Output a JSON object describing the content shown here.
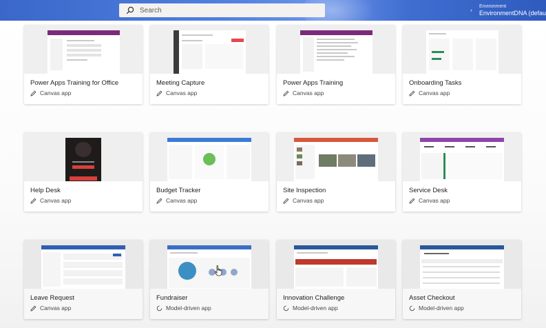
{
  "header": {
    "search_placeholder": "Search",
    "environment_label": "Environment",
    "environment_name": "EnvironmentDNA (defau"
  },
  "apps": [
    {
      "title": "Power Apps Training for Office",
      "type": "Canvas app",
      "type_icon": "pencil-icon",
      "accent": "#7b2a7b",
      "dark_thumb": false
    },
    {
      "title": "Meeting Capture",
      "type": "Canvas app",
      "type_icon": "pencil-icon",
      "accent": "#e8474c",
      "dark_thumb": false
    },
    {
      "title": "Power Apps Training",
      "type": "Canvas app",
      "type_icon": "pencil-icon",
      "accent": "#7b2a7b",
      "dark_thumb": false
    },
    {
      "title": "Onboarding Tasks",
      "type": "Canvas app",
      "type_icon": "pencil-icon",
      "accent": "#2e8b57",
      "dark_thumb": false
    },
    {
      "title": "Help Desk",
      "type": "Canvas app",
      "type_icon": "pencil-icon",
      "accent": "#d9403a",
      "dark_thumb": true
    },
    {
      "title": "Budget Tracker",
      "type": "Canvas app",
      "type_icon": "pencil-icon",
      "accent": "#3a7bd5",
      "dark_thumb": false
    },
    {
      "title": "Site Inspection",
      "type": "Canvas app",
      "type_icon": "pencil-icon",
      "accent": "#d9573a",
      "dark_thumb": false
    },
    {
      "title": "Service Desk",
      "type": "Canvas app",
      "type_icon": "pencil-icon",
      "accent": "#8e44ad",
      "dark_thumb": false
    },
    {
      "title": "Leave Request",
      "type": "Canvas app",
      "type_icon": "pencil-icon",
      "accent": "#2f5fb3",
      "dark_thumb": false
    },
    {
      "title": "Fundraiser",
      "type": "Model-driven app",
      "type_icon": "model-driven-icon",
      "accent": "#3b6fc4",
      "dark_thumb": false
    },
    {
      "title": "Innovation Challenge",
      "type": "Model-driven app",
      "type_icon": "model-driven-icon",
      "accent": "#c0392b",
      "dark_thumb": false
    },
    {
      "title": "Asset Checkout",
      "type": "Model-driven app",
      "type_icon": "model-driven-icon",
      "accent": "#2b579a",
      "dark_thumb": false
    }
  ],
  "colors": {
    "header_gradient_main": "#4f7fe0",
    "search_bg": "#f3f2f1",
    "card_bg": "#ffffff"
  }
}
